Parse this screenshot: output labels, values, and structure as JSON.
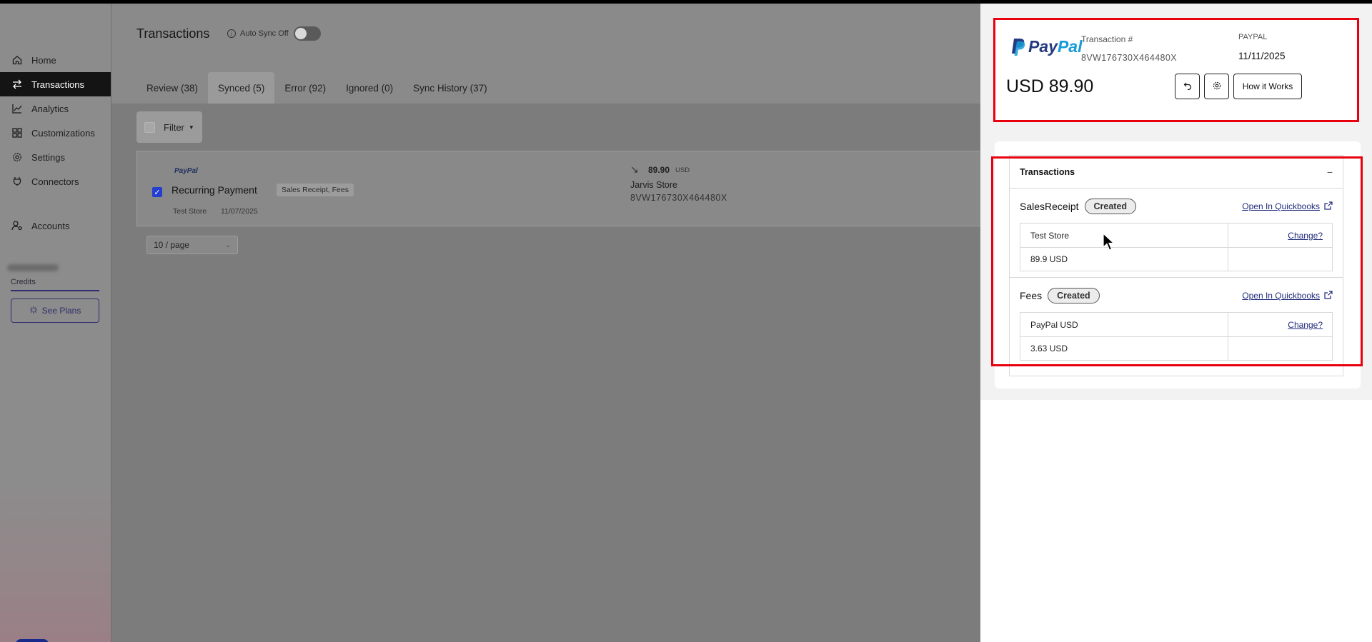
{
  "sidebar": {
    "items": [
      {
        "label": "Home",
        "icon": "home-icon"
      },
      {
        "label": "Transactions",
        "icon": "swap-icon",
        "active": true
      },
      {
        "label": "Analytics",
        "icon": "chart-line-icon"
      },
      {
        "label": "Customizations",
        "icon": "grid-icon"
      },
      {
        "label": "Settings",
        "icon": "gear-icon"
      },
      {
        "label": "Connectors",
        "icon": "plug-icon"
      }
    ],
    "accounts_label": "Accounts",
    "credits_label": "Credits",
    "see_plans_label": "See Plans"
  },
  "header": {
    "title": "Transactions",
    "auto_sync_label": "Auto Sync Off",
    "auto_sync_on": false
  },
  "tabs": [
    {
      "label": "Review (38)"
    },
    {
      "label": "Synced (5)",
      "active": true
    },
    {
      "label": "Error (92)"
    },
    {
      "label": "Ignored (0)"
    },
    {
      "label": "Sync History (37)"
    }
  ],
  "filter_label": "Filter",
  "transaction_row": {
    "provider": "PayPal",
    "title": "Recurring Payment",
    "tags": "Sales Receipt, Fees",
    "account": "Test Store",
    "date": "11/07/2025",
    "amount": "89.90",
    "currency": "USD",
    "store": "Jarvis Store",
    "transaction_id": "8VW176730X464480X",
    "checked": true
  },
  "pagination": {
    "page_size": "10 / page"
  },
  "drawer": {
    "provider_logo_left": "Pay",
    "provider_logo_right": "Pal",
    "transaction_label": "Transaction #",
    "transaction_id": "8VW176730X464480X",
    "source": "PAYPAL",
    "date": "11/11/2025",
    "amount": "USD 89.90",
    "how_it_works_label": "How it Works",
    "section_title": "Transactions",
    "entries": [
      {
        "type": "SalesReceipt",
        "status": "Created",
        "link_label": "Open In Quickbooks",
        "rows": [
          {
            "left": "Test Store",
            "right": "Change?"
          },
          {
            "left": "89.9 USD",
            "right": ""
          }
        ]
      },
      {
        "type": "Fees",
        "status": "Created",
        "link_label": "Open In Quickbooks",
        "rows": [
          {
            "left": "PayPal USD",
            "right": "Change?"
          },
          {
            "left": "3.63 USD",
            "right": ""
          }
        ]
      }
    ]
  },
  "colors": {
    "highlight": "#e8000e",
    "link": "#1f2a7a",
    "active_nav": "#141414",
    "paypal_dark": "#253b80",
    "paypal_light": "#179bd7"
  }
}
